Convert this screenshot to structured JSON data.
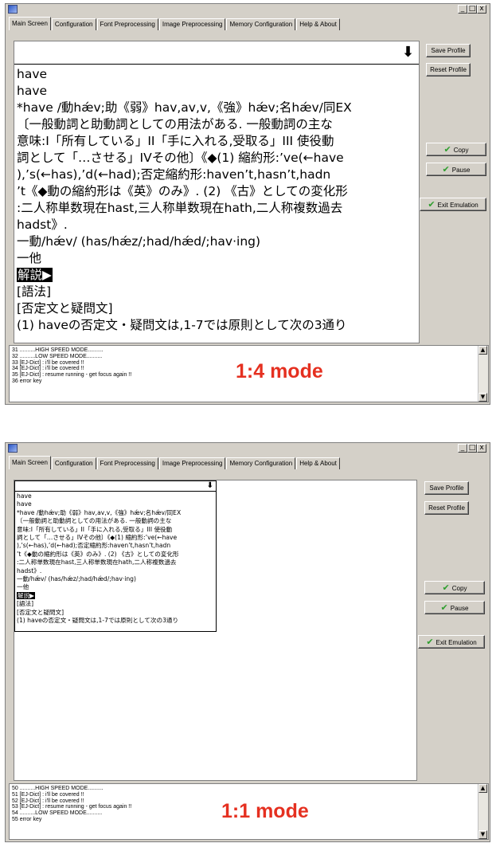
{
  "window_tabs": [
    "Main Screen",
    "Configuration",
    "Font Preprocessing",
    "Image Preprocessing",
    "Memory Configuration",
    "Help & About"
  ],
  "window_controls": [
    "_",
    "□",
    "x"
  ],
  "buttons": {
    "save_profile": "Save Profile",
    "reset_profile": "Reset Profile",
    "copy": "Copy",
    "pause": "Pause",
    "exit_emulation": "Exit Emulation"
  },
  "screen_arrow": "⬇",
  "dictionary_lines": [
    "have",
    "have",
    "*have /動hǽv;助《弱》hav,av,v,《強》hǽv;名hǽv/同EX",
    "〔一般動詞と助動詞としての用法がある. 一般動詞の主な",
    "意味:I「所有している」II「手に入れる,受取る」III 使役動",
    "詞として「…させる」IVその他〕《◆(1) 縮約形:’ve(←have",
    "),’s(←has),’d(←had);否定縮約形:haven’t,hasn’t,hadn",
    "’t《◆動の縮約形は《英》のみ》. (2) 《古》としての変化形",
    ":二人称単数現在hast,三人称単数現在hath,二人称複数過去",
    "hadst》.",
    "一動/hǽv/ (has/hǽz/;had/hǽd/;hav·ing)",
    "一他",
    "解説▶",
    "[語法]",
    "[否定文と疑問文]",
    "(1) haveの否定文・疑問文は,1-7では原則として次の3通り"
  ],
  "log_1": [
    "31 ..........HIGH SPEED MODE..........",
    "32 ..........LOW SPEED MODE..........",
    "33 [EJ-Dict] : i'll be covered !!",
    "34 [EJ-Dict] : i'll be covered !!",
    "35 [EJ-Dict] : resume running - get focus again !!",
    "36 error key"
  ],
  "log_2": [
    "50 ..........HIGH SPEED MODE..........",
    "51 [EJ-Dict] : i'll be covered !!",
    "52 [EJ-Dict] : i'll be covered !!",
    "53 [EJ-Dict] : resume running - get focus again !!",
    "54 ..........LOW SPEED MODE..........",
    "55 error key"
  ],
  "mode_1": "1:4 mode",
  "mode_2": "1:1 mode"
}
